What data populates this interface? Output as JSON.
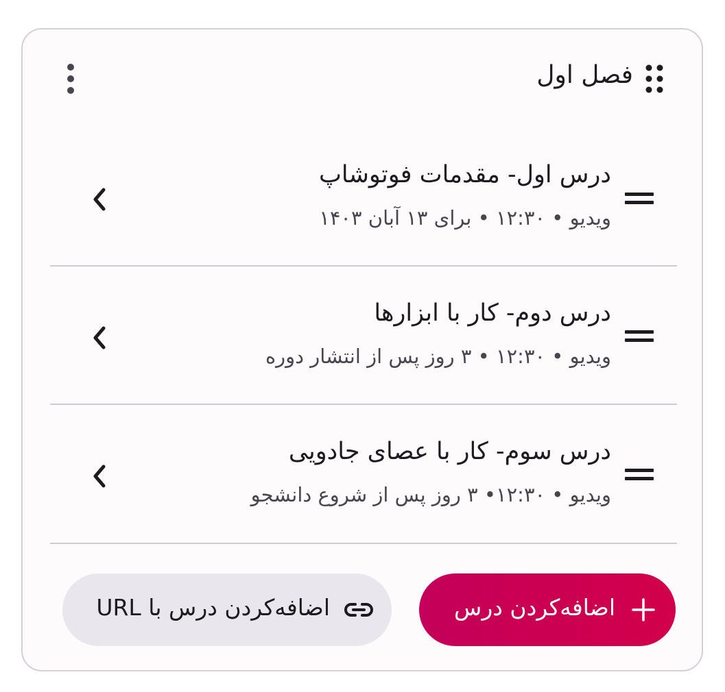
{
  "section": {
    "title": "فصل اول"
  },
  "lessons": [
    {
      "title": "درس اول- مقدمات فوتوشاپ",
      "meta": "ویدیو • ۱۲:۳۰ • برای ۱۳ آبان ۱۴۰۳"
    },
    {
      "title": "درس دوم- کار با ابزارها",
      "meta": "ویدیو • ۱۲:۳۰ • ۳ روز پس از انتشار دوره"
    },
    {
      "title": "درس سوم- کار با عصای جادویی",
      "meta": "ویدیو • ۱۲:۳۰• ۳ روز پس از شروع دانشجو"
    }
  ],
  "actions": {
    "add_lesson": "اضافه‌کردن درس",
    "add_lesson_url": "اضافه‌کردن درس با URL"
  },
  "icons": {
    "drag": "drag-dots-icon",
    "more": "more-vertical-icon",
    "handle": "drag-handle-icon",
    "chevron": "chevron-left-icon",
    "plus": "plus-icon",
    "link": "link-icon"
  },
  "colors": {
    "accent": "#c8004f",
    "secondary_button": "#e9e6ee",
    "card_border": "#d4d0d6",
    "text": "#1c1b1f",
    "muted_text": "#49454f"
  }
}
